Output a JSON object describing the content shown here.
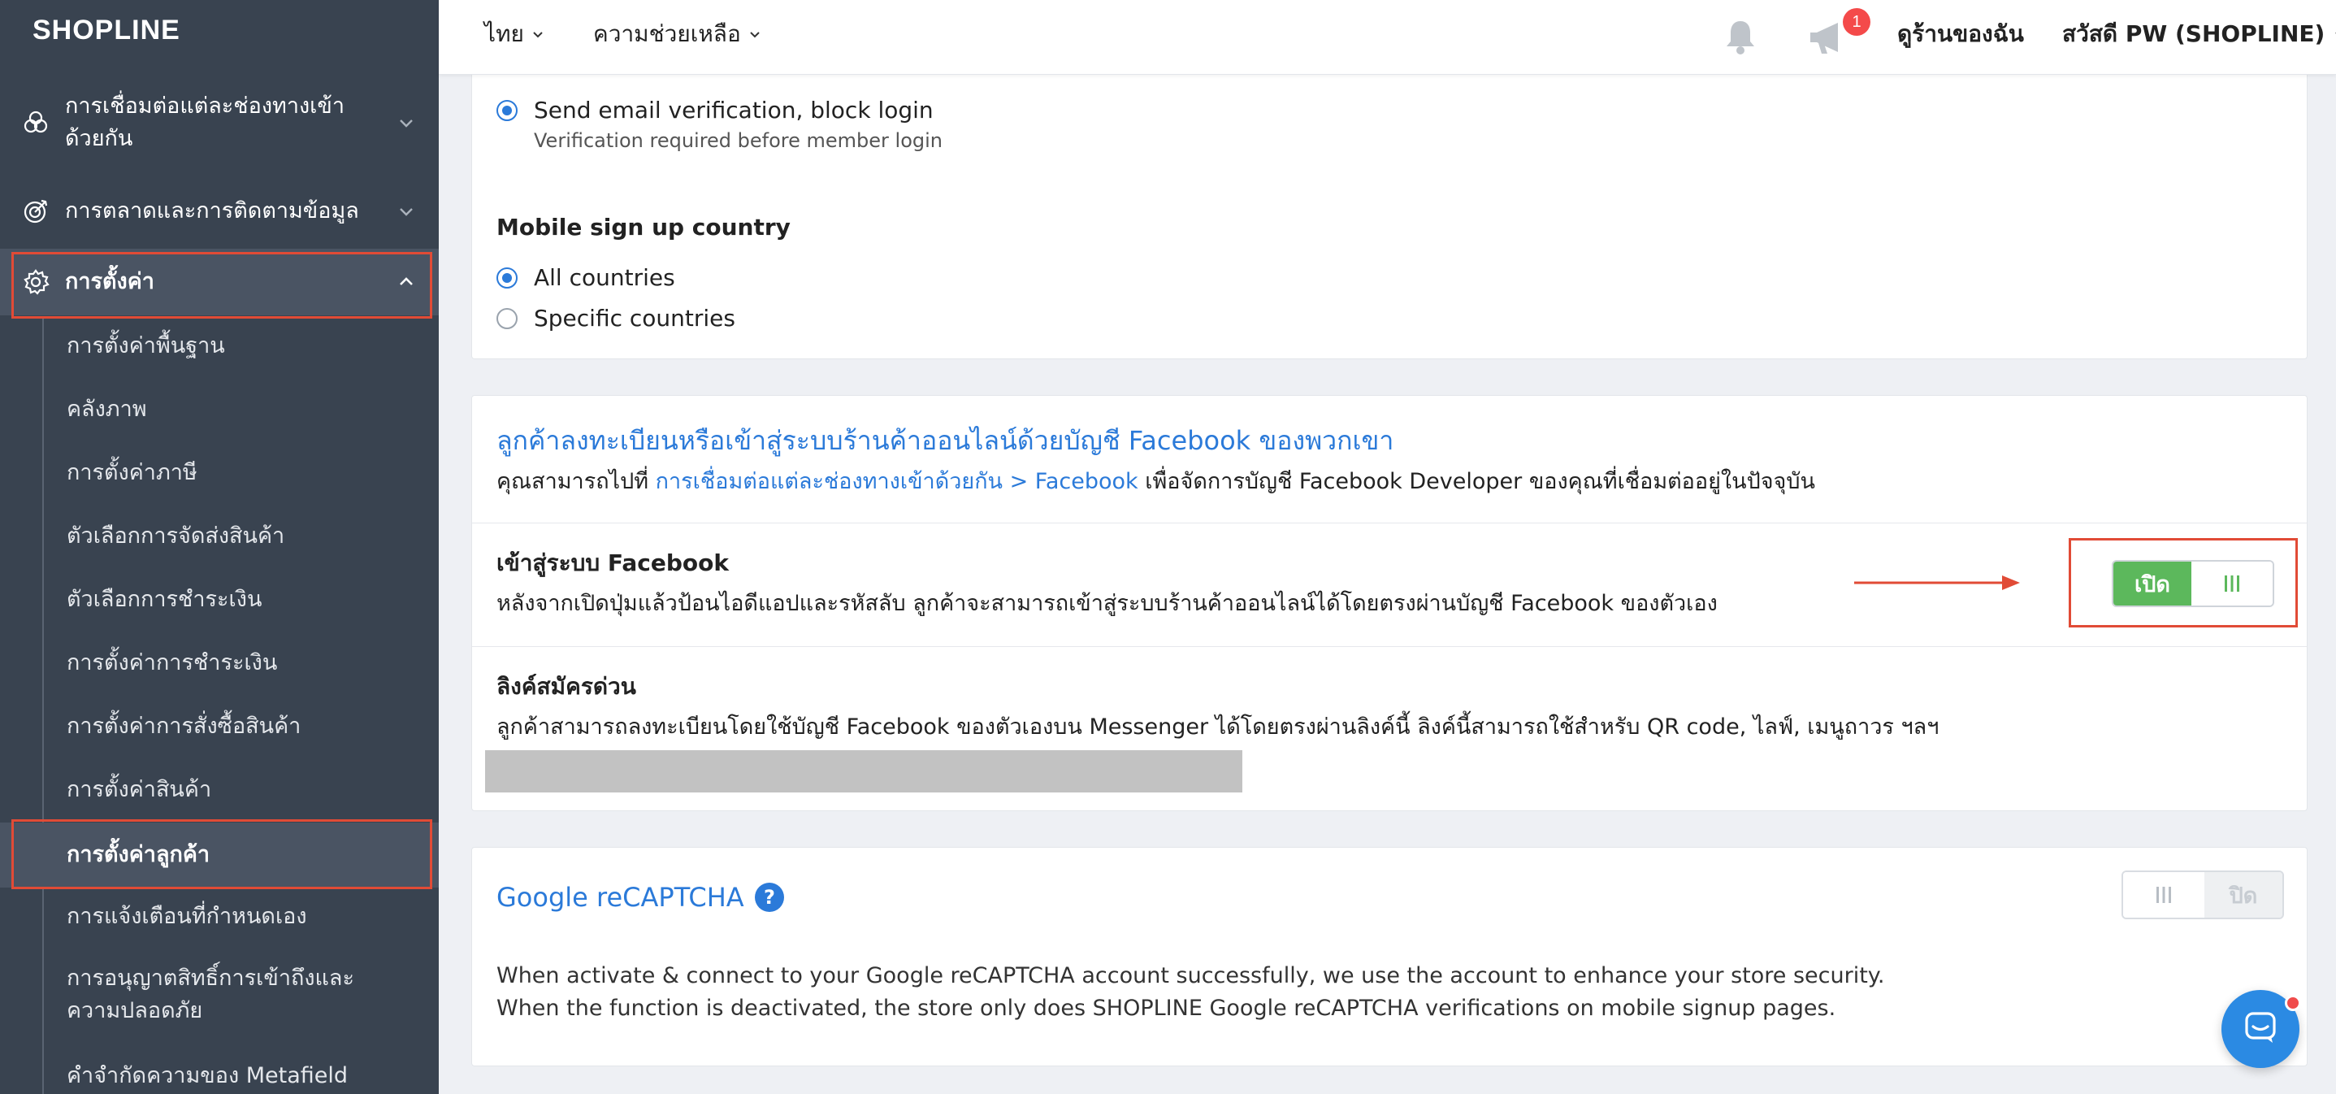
{
  "sidebar": {
    "brand": "SHOPLINE",
    "groups": [
      {
        "label": "การเชื่อมต่อแต่ละช่องทางเข้าด้วยกัน",
        "icon": "channels-icon"
      },
      {
        "label": "การตลาดและการติดตามข้อมูล",
        "icon": "target-icon"
      },
      {
        "label": "การตั้งค่า",
        "icon": "gear-icon",
        "expanded": true
      }
    ],
    "items": [
      {
        "label": "การตั้งค่าพื้นฐาน"
      },
      {
        "label": "คลังภาพ"
      },
      {
        "label": "การตั้งค่าภาษี"
      },
      {
        "label": "ตัวเลือกการจัดส่งสินค้า"
      },
      {
        "label": "ตัวเลือกการชำระเงิน"
      },
      {
        "label": "การตั้งค่าการชำระเงิน"
      },
      {
        "label": "การตั้งค่าการสั่งซื้อสินค้า"
      },
      {
        "label": "การตั้งค่าสินค้า"
      },
      {
        "label": "การตั้งค่าลูกค้า",
        "active": true
      },
      {
        "label": "การแจ้งเตือนที่กำหนดเอง"
      },
      {
        "label": "การอนุญาตสิทธิ์การเข้าถึงและความปลอดภัย"
      },
      {
        "label": "คำจำกัดความของ Metafield"
      }
    ]
  },
  "topbar": {
    "language": "ไทย",
    "help": "ความช่วยเหลือ",
    "notification_count": "1",
    "view_store": "ดูร้านของฉัน",
    "greeting": "สวัสดี PW (SHOPLINE)"
  },
  "verification": {
    "option_label": "Send email verification, block login",
    "option_hint": "Verification required before member login"
  },
  "signup_country": {
    "title": "Mobile sign up country",
    "options": [
      {
        "label": "All countries",
        "checked": true
      },
      {
        "label": "Specific countries",
        "checked": false
      }
    ]
  },
  "facebook": {
    "heading": "ลูกค้าลงทะเบียนหรือเข้าสู่ระบบร้านค้าออนไลน์ด้วยบัญชี Facebook ของพวกเขา",
    "desc_prefix": "คุณสามารถไปที่",
    "desc_link": "การเชื่อมต่อแต่ละช่องทางเข้าด้วยกัน > Facebook",
    "desc_suffix": "เพื่อจัดการบัญชี Facebook Developer ของคุณที่เชื่อมต่ออยู่ในปัจจุบัน",
    "login_title": "เข้าสู่ระบบ Facebook",
    "login_desc": "หลังจากเปิดปุ่มแล้วป้อนไอดีแอปและรหัสลับ ลูกค้าจะสามารถเข้าสู่ระบบร้านค้าออนไลน์ได้โดยตรงผ่านบัญชี Facebook ของตัวเอง",
    "toggle_label": "เปิด",
    "toggle_on": true,
    "quick_link_title": "ลิงค์สมัครด่วน",
    "quick_link_desc": "ลูกค้าสามารถลงทะเบียนโดยใช้บัญชี Facebook ของตัวเองบน Messenger ได้โดยตรงผ่านลิงค์นี้ ลิงค์นี้สามารถใช้สำหรับ QR code, ไลฟ์, เมนูถาวร ฯลฯ"
  },
  "recaptcha": {
    "title": "Google reCAPTCHA",
    "toggle_label": "ปิด",
    "toggle_on": false,
    "desc_line1": "When activate & connect to your Google reCAPTCHA account successfully, we use the account to enhance your store security.",
    "desc_line2": "When the function is deactivated, the store only does SHOPLINE Google reCAPTCHA verifications on mobile signup pages."
  },
  "colors": {
    "sidebar_bg": "#394350",
    "accent_blue": "#2b7ad9",
    "toggle_green": "#5cb85c",
    "highlight_red": "#e14b36"
  }
}
